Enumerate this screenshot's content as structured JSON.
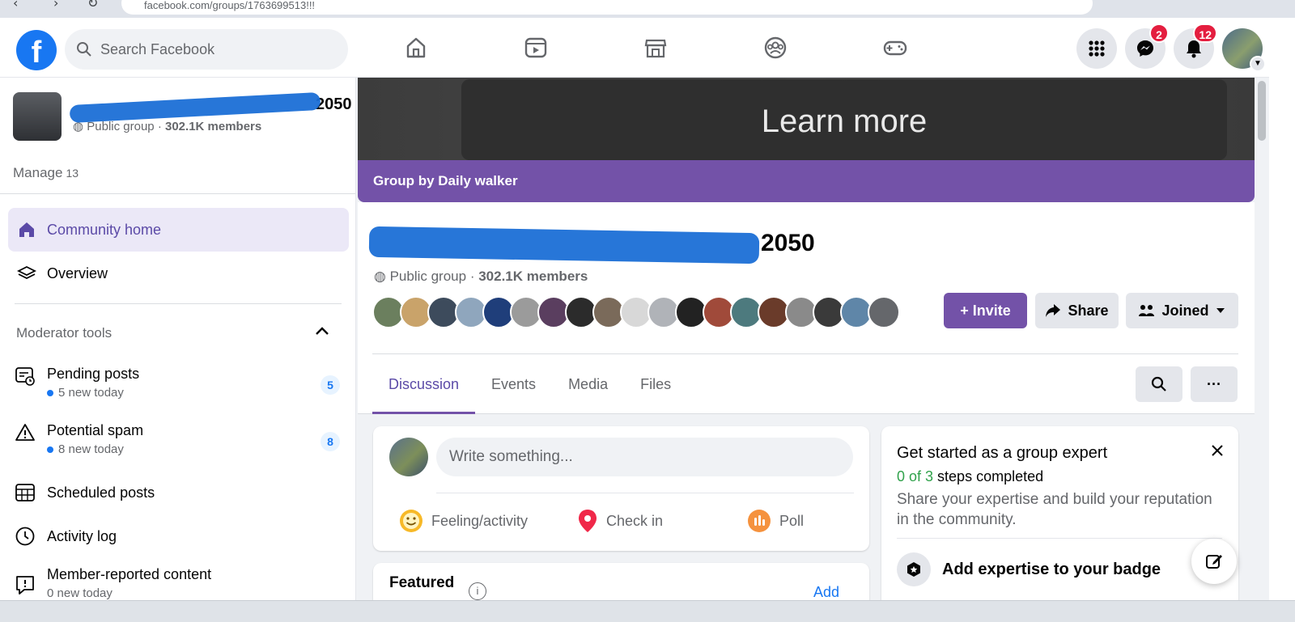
{
  "browser": {
    "url": "facebook.com/groups/1763699513!!!"
  },
  "topbar": {
    "logo": "f",
    "search_placeholder": "Search Facebook",
    "nav_icons": [
      "home-icon",
      "video-icon",
      "marketplace-icon",
      "groups-icon",
      "gaming-icon"
    ],
    "messenger_badge": "2",
    "notifications_badge": "12"
  },
  "sidebar": {
    "group_name": "Covered ... 2050",
    "group_privacy": "Public group",
    "group_members": "302.1K members",
    "manage_label": "Manage",
    "manage_count": "13",
    "items": [
      {
        "label": "Community home",
        "icon": "home-icon"
      },
      {
        "label": "Overview",
        "icon": "layers-icon"
      }
    ],
    "moderator_title": "Moderator tools",
    "tools": [
      {
        "label": "Pending posts",
        "sub": "5 new today",
        "count": "5"
      },
      {
        "label": "Potential spam",
        "sub": "8 new today",
        "count": "8"
      },
      {
        "label": "Scheduled posts"
      },
      {
        "label": "Activity log"
      },
      {
        "label": "Member-reported content",
        "sub": "0 new today"
      }
    ]
  },
  "cover": {
    "text": "Learn more",
    "strip": "Group by Daily walker"
  },
  "group": {
    "title": "Covered ... 2050",
    "title_visible_suffix": "2050",
    "privacy": "Public group",
    "members": "302.1K members",
    "invite": "+ Invite",
    "share": "Share",
    "joined": "Joined"
  },
  "tabs": [
    "Discussion",
    "Events",
    "Media",
    "Files"
  ],
  "composer": {
    "placeholder": "Write something...",
    "actions": [
      "Feeling/activity",
      "Check in",
      "Poll"
    ]
  },
  "featured": {
    "title": "Featured",
    "add": "Add"
  },
  "expert": {
    "title": "Get started as a group expert",
    "steps_done": "0 of 3",
    "steps_suffix": " steps completed",
    "desc": "Share your expertise and build your reputation in the community.",
    "item": "Add expertise to your badge"
  },
  "colors": {
    "accent": "#7352a8",
    "fb_blue": "#1877f2",
    "badge_red": "#e41e3f"
  }
}
